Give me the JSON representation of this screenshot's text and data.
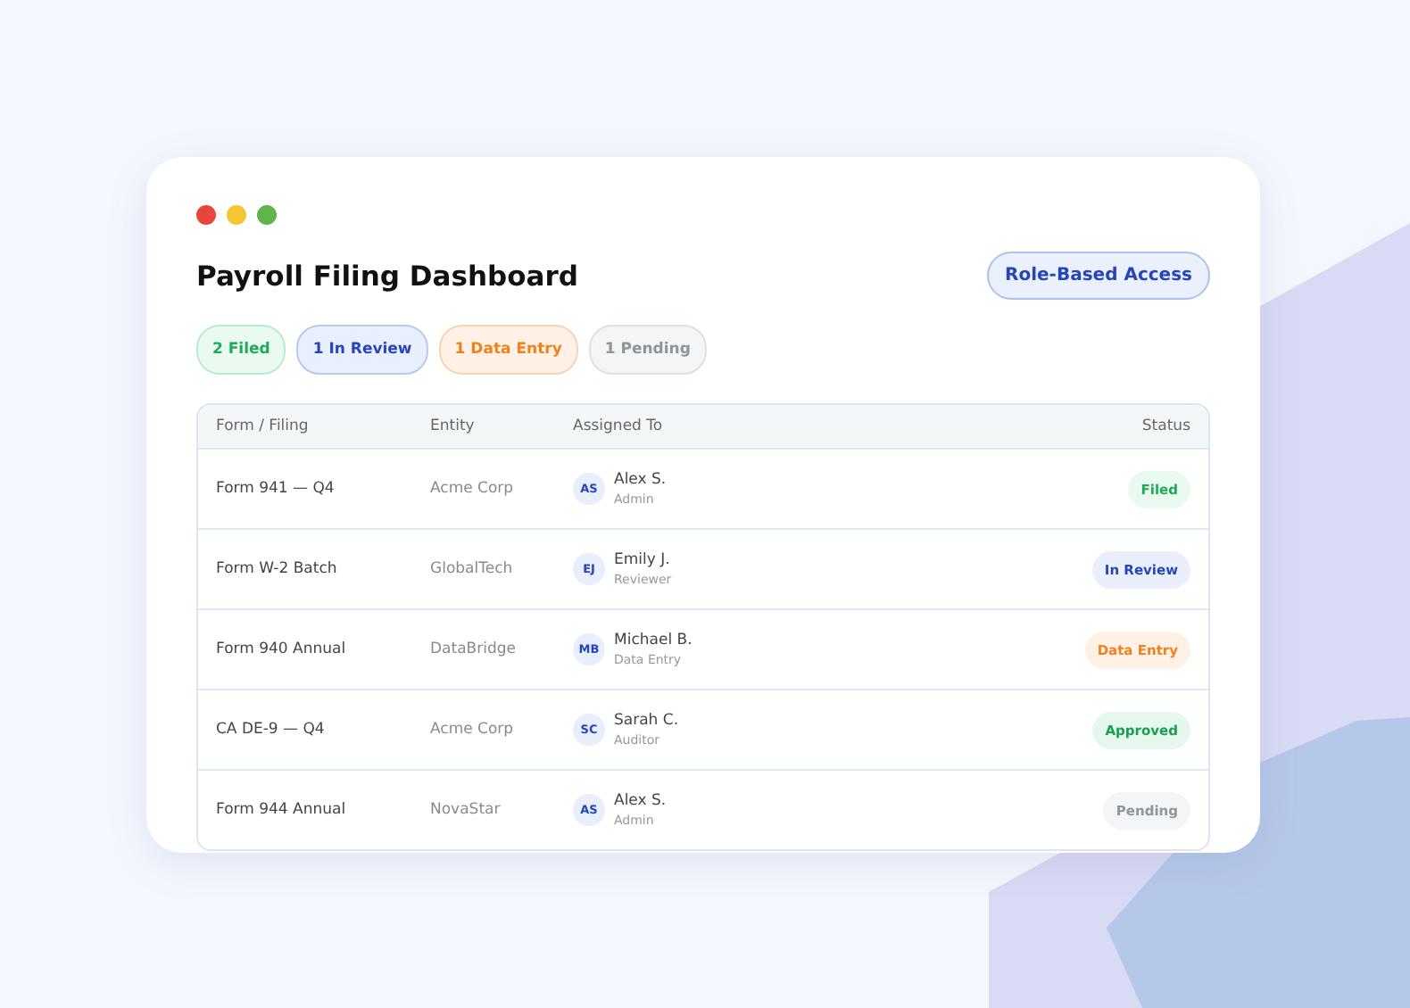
{
  "window": {
    "title": "Payroll Filing Dashboard"
  },
  "access_button": "Role-Based Access",
  "summary": [
    {
      "label": "2 Filed",
      "kind": "filed"
    },
    {
      "label": "1 In Review",
      "kind": "review"
    },
    {
      "label": "1 Data Entry",
      "kind": "entry"
    },
    {
      "label": "1 Pending",
      "kind": "pending"
    }
  ],
  "table": {
    "columns": [
      "Form / Filing",
      "Entity",
      "Assigned To",
      "Status"
    ],
    "rows": [
      {
        "form": "Form 941 — Q4",
        "entity": "Acme Corp",
        "initials": "AS",
        "name": "Alex S.",
        "role": "Admin",
        "status": "Filed",
        "kind": "filed"
      },
      {
        "form": "Form W-2 Batch",
        "entity": "GlobalTech",
        "initials": "EJ",
        "name": "Emily J.",
        "role": "Reviewer",
        "status": "In Review",
        "kind": "review"
      },
      {
        "form": "Form 940 Annual",
        "entity": "DataBridge",
        "initials": "MB",
        "name": "Michael B.",
        "role": "Data Entry",
        "status": "Data Entry",
        "kind": "entry"
      },
      {
        "form": "CA DE-9 — Q4",
        "entity": "Acme Corp",
        "initials": "SC",
        "name": "Sarah C.",
        "role": "Auditor",
        "status": "Approved",
        "kind": "approved"
      },
      {
        "form": "Form 944 Annual",
        "entity": "NovaStar",
        "initials": "AS",
        "name": "Alex S.",
        "role": "Admin",
        "status": "Pending",
        "kind": "pending"
      }
    ]
  }
}
